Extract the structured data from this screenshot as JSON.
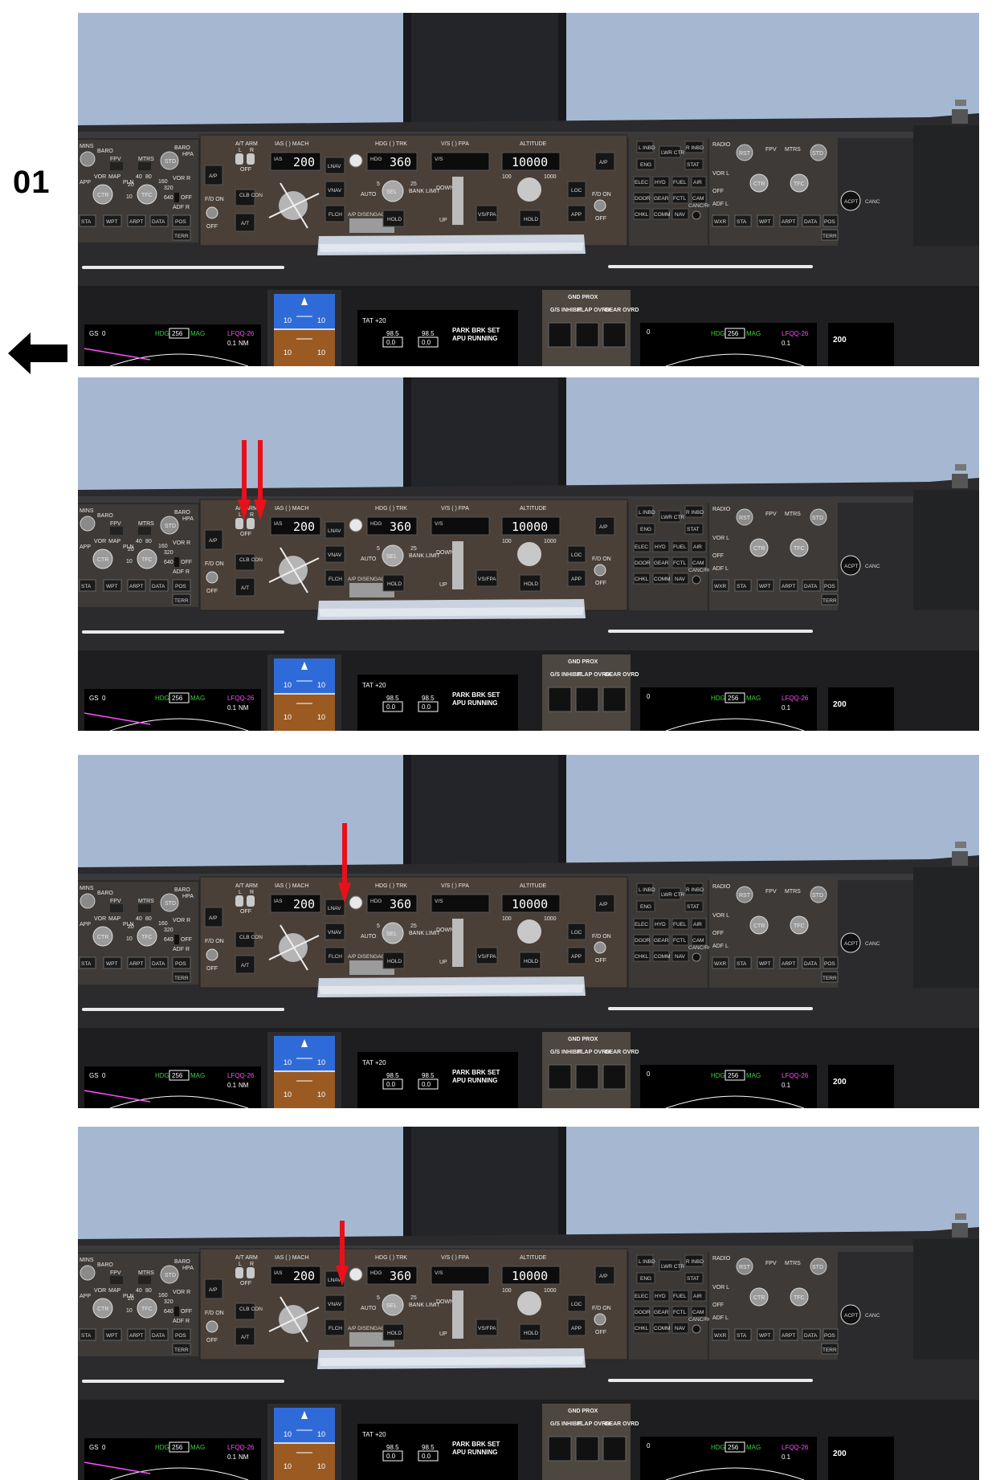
{
  "page": {
    "number": "01"
  },
  "autopilot_panel": {
    "ap_label": "A/P",
    "at_arm_label": "A/T ARM",
    "at_l": "L",
    "at_r": "R",
    "at_off": "OFF",
    "clb_con": "CLB CON",
    "at_label": "A/T",
    "fd_on": "F/D ON",
    "fd_off": "OFF",
    "ias_mach_label": "IAS (   ) MACH",
    "ias_tag": "IAS",
    "ias_value": "200",
    "lnav": "LNAV",
    "vnav": "VNAV",
    "flch": "FLCH",
    "ap_disengage": "A/P DISENGAGE",
    "hdg_trk_label": "HDG (   ) TRK",
    "hdg_tag": "HDG",
    "hdg_value": "360",
    "auto": "AUTO",
    "sel": "SEL",
    "bank_limit": "BANK LIMIT",
    "bank_5": "5",
    "bank_25": "25",
    "hold": "HOLD",
    "vs_fpa_label": "V/S (   ) FPA",
    "vs_tag": "V/S",
    "down": "DOWN",
    "up": "UP",
    "vs_fpa_button": "VS/FPA",
    "altitude_label": "ALTITUDE",
    "altitude_value": "10000",
    "alt_100": "100",
    "alt_1000": "1000",
    "loc": "LOC",
    "app": "APP"
  },
  "efis_left": {
    "mins": "MINS",
    "baro": "BARO",
    "rst": "RST",
    "std": "STD",
    "hpa": "HPA",
    "fpv": "FPV",
    "mtrs": "MTRS",
    "vor_l": "VOR L",
    "app": "APP",
    "vor": "VOR",
    "map": "MAP",
    "pln": "PLN",
    "ctr": "CTR",
    "tfc": "TFC",
    "r10": "10",
    "r20": "20",
    "r40": "40",
    "r80": "80",
    "r160": "160",
    "r320": "320",
    "r640": "640",
    "vor_r": "VOR R",
    "off": "OFF",
    "adf_l": "ADF L",
    "adf_r": "ADF R",
    "wxr": "WXR",
    "sta": "STA",
    "wpt": "WPT",
    "arpt": "ARPT",
    "data": "DATA",
    "pos": "POS",
    "terr": "TERR"
  },
  "display_select": {
    "l_inbd": "L INBD",
    "lwr_ctr": "LWR CTR",
    "r_inbd": "R INBD",
    "eng": "ENG",
    "stat": "STAT",
    "elec": "ELEC",
    "hyd": "HYD",
    "fuel": "FUEL",
    "air": "AIR",
    "door": "DOOR",
    "gear": "GEAR",
    "fctl": "FCTL",
    "cam": "CAM",
    "chkl": "CHKL",
    "comm": "COMM",
    "nav": "NAV",
    "canc_rcl": "CANC/RCL"
  },
  "efis_right": {
    "radio": "RADIO",
    "acpt": "ACPT",
    "canc": "CANC"
  },
  "lower_displays": {
    "gs_label": "GS",
    "gs_value": "0",
    "hdg_label": "HDG",
    "hdg_value": "256",
    "mag": "MAG",
    "waypoint": "LFQQ-26",
    "dist": "0.1",
    "nm": "NM",
    "pfd_10a": "10",
    "pfd_10b": "10",
    "tat": "TAT +20",
    "n1_left": "98.5",
    "n1_right": "98.5",
    "n1_left_box": "0.0",
    "n1_right_box": "0.0",
    "park_brk": "PARK BRK SET",
    "apu_running": "APU RUNNING",
    "gnd_prox": "GND PROX",
    "gs_inhibit": "G/S INHIBIT",
    "flap_ovrd": "FLAP OVRD",
    "gear_ovrd": "GEAR OVRD",
    "speed_tape": "200"
  },
  "colors": {
    "annotation_arrow": "#e8101a",
    "sky": "#a6b8d1",
    "panel": "#4a4038",
    "glareshield": "#2b2b2d"
  },
  "icons": {
    "back": "left-arrow-icon",
    "annotation": "down-arrow-icon"
  }
}
